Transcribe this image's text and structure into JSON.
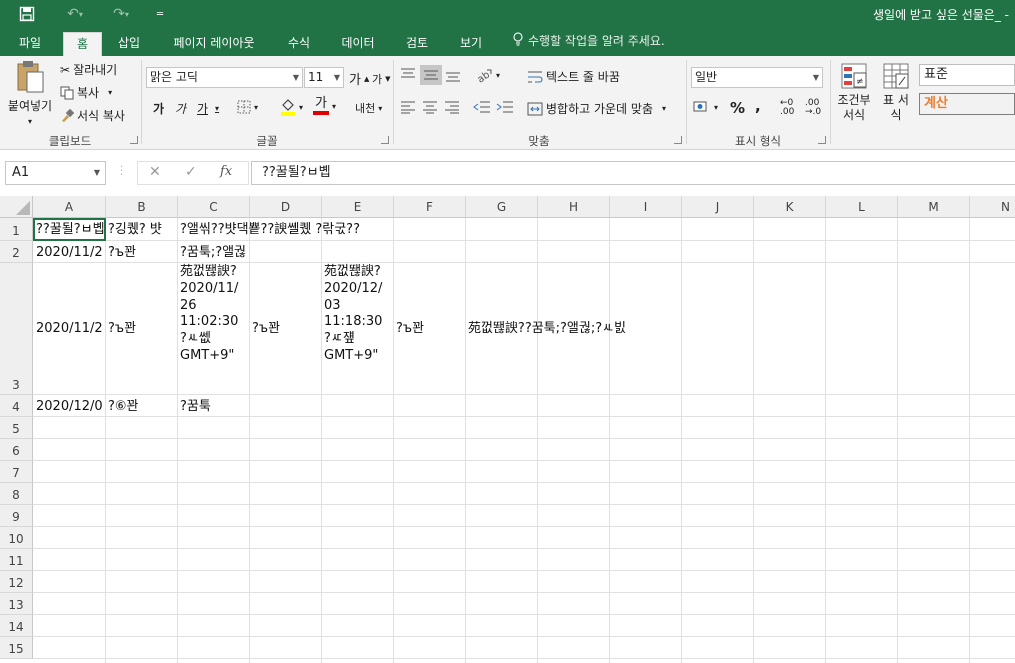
{
  "window": {
    "title": "생일에 받고 싶은 선물은_ -"
  },
  "tabs": [
    "파일",
    "홈",
    "삽입",
    "페이지 레이아웃",
    "수식",
    "데이터",
    "검토",
    "보기"
  ],
  "tell_me": "수행할 작업을 알려 주세요.",
  "ribbon": {
    "clipboard": {
      "paste": "붙여넣기",
      "cut": "잘라내기",
      "copy": "복사",
      "format_painter": "서식 복사",
      "label": "클립보드"
    },
    "font": {
      "name": "맑은 고딕",
      "size": "11",
      "bold": "가",
      "italic": "가",
      "underline": "가",
      "font_color": "가",
      "phonetic": "내천",
      "label": "글꼴"
    },
    "alignment": {
      "wrap_text": "텍스트 줄 바꿈",
      "merge_center": "병합하고 가운데 맞춤",
      "label": "맞춤"
    },
    "number": {
      "format": "일반",
      "percent": "%",
      "comma": ",",
      "label": "표시 형식"
    },
    "styles": {
      "conditional": "조건부 서식",
      "table": "표 서식",
      "normal": "표준",
      "calculation": "계산"
    }
  },
  "formula_bar": {
    "name_box": "A1",
    "fx": "fx",
    "value": "??꿀될?ㅂ볩"
  },
  "colors": {
    "excel_green": "#217346",
    "calc_orange": "#ed7d31",
    "grid": "#e0e0e0"
  },
  "columns": [
    "A",
    "B",
    "C",
    "D",
    "E",
    "F",
    "G",
    "H",
    "I",
    "J",
    "K",
    "L",
    "M",
    "N"
  ],
  "rows": [
    "1",
    "2",
    "3",
    "4",
    "5",
    "6",
    "7",
    "8",
    "9",
    "10",
    "11",
    "12",
    "13",
    "14",
    "15"
  ],
  "cells": {
    "A1": "??꿀될?ㅂ볩",
    "B1": "?깅퀬? 뱟",
    "C1": "?앨씪??뱟댁뿉??諛쏄퀬 ?띾굯??",
    "A2": "2020/11/2",
    "B2": "?ъ꽌",
    "C2": "?꿈툭;?앨궎",
    "A3": "2020/11/2",
    "B3": "?ъ꽌",
    "C3": "苑껎뙎諛? 2020/11/ 26 11:02:30 ?ㅻ쎖 GMT+9\"",
    "D3": "?ъ꽌",
    "E3": "苑껎뙎諛? 2020/12/ 03 11:18:30 ?ㅼ쟾 GMT+9\"",
    "F3": "?ъ꽌",
    "G3": "苑껎뙎諛??꿈툭;?앨궎;?ㅻ빐",
    "A4": "2020/12/0",
    "B4": "?⑥꽌",
    "C4": "?꿈툭"
  }
}
